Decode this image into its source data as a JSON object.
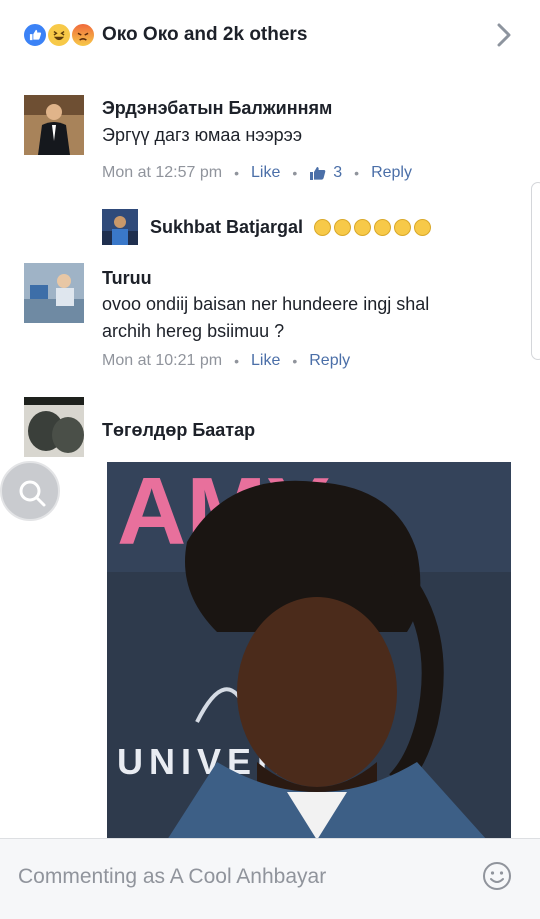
{
  "reactions": {
    "summary": "Око Око and 2k others"
  },
  "comments": [
    {
      "author": "Эрдэнэбатын Балжинням",
      "text": "Эргүү дагз юмаа нээрээ",
      "time": "Mon at 12:57 pm",
      "like": "Like",
      "like_count": "3",
      "reply": "Reply"
    },
    {
      "author": "Sukhbat Batjargal",
      "text": ""
    },
    {
      "author": "Turuu",
      "text_lines": [
        "ovoo ondiij baisan ner hundeere ingj shal",
        "archih hereg bsiimuu ?"
      ],
      "time": "Mon at 10:21 pm",
      "like": "Like",
      "reply": "Reply"
    },
    {
      "author": "Төгөлдөр Баатар"
    }
  ],
  "image_overlay": {
    "banner_text": "AMY",
    "logo_text": "UNIVER"
  },
  "composer": {
    "placeholder": "Commenting as A Cool Anhbayar"
  },
  "colors": {
    "accent": "#4b6fa8",
    "meta": "#90949c",
    "like": "#3b82f6"
  },
  "icons": [
    "like-reaction-icon",
    "haha-reaction-icon",
    "angry-reaction-icon",
    "chevron-right-icon",
    "thumbs-up-icon",
    "search-icon",
    "smiley-icon"
  ]
}
